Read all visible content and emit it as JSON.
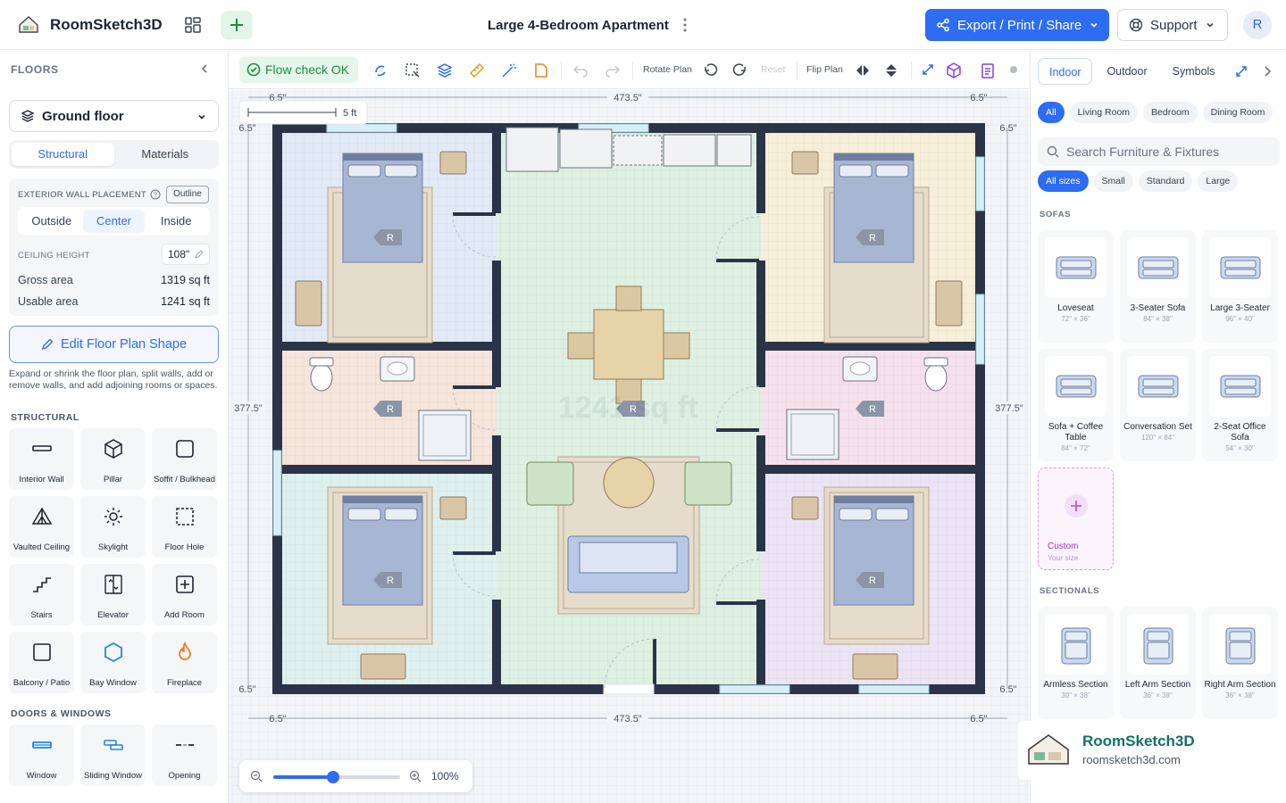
{
  "app": {
    "title": "RoomSketch3D",
    "doc_title": "Large 4-Bedroom Apartment",
    "export_label": "Export / Print / Share",
    "support_label": "Support",
    "avatar_initial": "R"
  },
  "left": {
    "floors_heading": "FLOORS",
    "floor_selected": "Ground floor",
    "tabs": [
      "Structural",
      "Materials"
    ],
    "exterior_wall_label": "EXTERIOR WALL PLACEMENT",
    "outline_label": "Outline",
    "placement_options": [
      "Outside",
      "Center",
      "Inside"
    ],
    "ceiling_label": "CEILING HEIGHT",
    "ceiling_value": "108\"",
    "gross_label": "Gross area",
    "gross_value": "1319 sq ft",
    "usable_label": "Usable area",
    "usable_value": "1241 sq ft",
    "edit_label": "Edit Floor Plan Shape",
    "help_text": "Expand or shrink the floor plan, split walls, add or remove walls, and add adjoining rooms or spaces.",
    "structural_heading": "STRUCTURAL",
    "structural_items": [
      {
        "label": "Interior Wall",
        "icon": "interior-wall"
      },
      {
        "label": "Pillar",
        "icon": "pillar"
      },
      {
        "label": "Soffit / Bulkhead",
        "icon": "soffit"
      },
      {
        "label": "Vaulted Ceiling",
        "icon": "vaulted-ceiling"
      },
      {
        "label": "Skylight",
        "icon": "skylight"
      },
      {
        "label": "Floor Hole",
        "icon": "floor-hole"
      },
      {
        "label": "Stairs",
        "icon": "stairs"
      },
      {
        "label": "Elevator",
        "icon": "elevator"
      },
      {
        "label": "Add Room",
        "icon": "add-room"
      },
      {
        "label": "Balcony / Patio",
        "icon": "balcony"
      },
      {
        "label": "Bay Window",
        "icon": "bay-window"
      },
      {
        "label": "Fireplace",
        "icon": "fireplace"
      }
    ],
    "doors_heading": "DOORS & WINDOWS",
    "door_items": [
      {
        "label": "Window",
        "icon": "window"
      },
      {
        "label": "Sliding Window",
        "icon": "sliding-window"
      },
      {
        "label": "Opening",
        "icon": "opening"
      }
    ]
  },
  "toolbar": {
    "flow_label": "Flow check OK",
    "rotate_label": "Rotate Plan",
    "reset_label": "Reset",
    "flip_label": "Flip Plan"
  },
  "canvas": {
    "scale_label": "5 ft",
    "dim_top": "473.5\"",
    "dim_bottom": "473.5\"",
    "dim_left": "377.5\"",
    "dim_right": "377.5\"",
    "dim_corner": "6.5\"",
    "area_watermark": "1241 sq ft",
    "room_badge": "R",
    "zoom_value": 100,
    "zoom_label": "100%"
  },
  "right": {
    "tabs": [
      "Indoor",
      "Outdoor",
      "Symbols"
    ],
    "room_chips": [
      "All",
      "Living Room",
      "Bedroom",
      "Dining Room"
    ],
    "search_placeholder": "Search Furniture & Fixtures",
    "size_chips": [
      "All sizes",
      "Small",
      "Standard",
      "Large"
    ],
    "sofas_heading": "SOFAS",
    "sofas": [
      {
        "name": "Loveseat",
        "dims": "72\" × 36\""
      },
      {
        "name": "3-Seater Sofa",
        "dims": "84\" × 38\""
      },
      {
        "name": "Large 3-Seater",
        "dims": "96\" × 40\""
      },
      {
        "name": "Sofa + Coffee Table",
        "dims": "84\" × 72\""
      },
      {
        "name": "Conversation Set",
        "dims": "120\" × 84\""
      },
      {
        "name": "2-Seat Office Sofa",
        "dims": "54\" × 30\""
      }
    ],
    "custom_label": "Custom",
    "custom_sub": "Your size",
    "sectionals_heading": "SECTIONALS",
    "sectionals": [
      {
        "name": "Armless Section",
        "dims": "30\" × 38\""
      },
      {
        "name": "Left Arm Section",
        "dims": "36\" × 38\""
      },
      {
        "name": "Right Arm Section",
        "dims": "36\" × 38\""
      }
    ]
  },
  "brand": {
    "name": "RoomSketch3D",
    "url": "roomsketch3d.com"
  },
  "colors": {
    "accent": "#2e6cf2",
    "wall": "#2b3447",
    "ok_green": "#1f8a3d",
    "bed_tl": "#e3eaf7",
    "bed_tr": "#f7efd9",
    "bath_l": "#f6e5db",
    "bath_r": "#f5e1ec",
    "bed_bl": "#dff1ef",
    "bed_br": "#ece4f5",
    "living": "#ddf0e2"
  }
}
